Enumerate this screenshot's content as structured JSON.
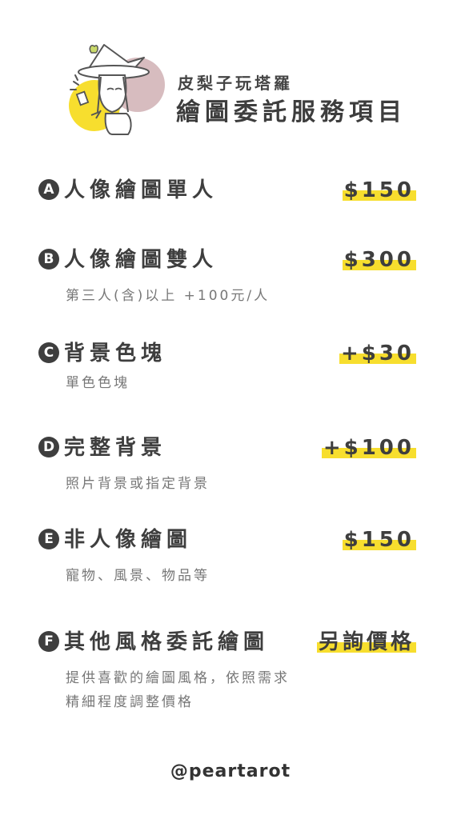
{
  "header": {
    "brand": "皮梨子玩塔羅",
    "title": "繪圖委託服務項目"
  },
  "items": [
    {
      "badge": "A",
      "name": "人像繪圖單人",
      "price": "$150",
      "desc": []
    },
    {
      "badge": "B",
      "name": "人像繪圖雙人",
      "price": "$300",
      "desc": [
        "第三人(含)以上 +100元/人"
      ]
    },
    {
      "badge": "C",
      "name": "背景色塊",
      "price": "+$30",
      "desc": [
        "單色色塊"
      ]
    },
    {
      "badge": "D",
      "name": "完整背景",
      "price": "+$100",
      "desc": [
        "照片背景或指定背景"
      ]
    },
    {
      "badge": "E",
      "name": "非人像繪圖",
      "price": "$150",
      "desc": [
        "寵物、風景、物品等"
      ]
    },
    {
      "badge": "F",
      "name": "其他風格委託繪圖",
      "price": "另詢價格",
      "desc": [
        "提供喜歡的繪圖風格，依照需求",
        "精細程度調整價格"
      ]
    }
  ],
  "footer": {
    "handle": "@peartarot"
  },
  "colors": {
    "highlight": "#f7de2e",
    "text": "#3e3e3e",
    "muted": "#777777",
    "avatar_yellow": "#f7de2e",
    "avatar_pink": "#d7bcbf"
  },
  "icons": [
    "witch-avatar-illustration"
  ]
}
